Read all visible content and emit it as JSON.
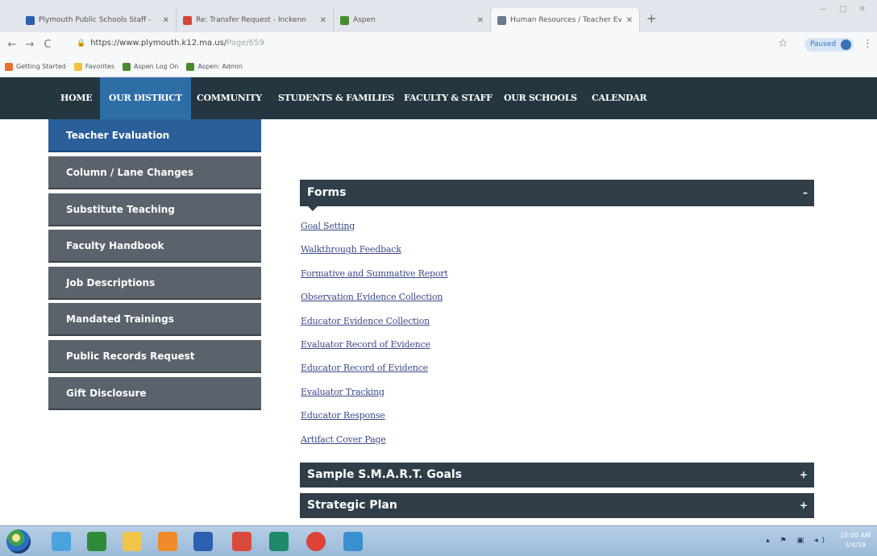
{
  "browser": {
    "tabs": [
      {
        "title": "Plymouth Public Schools Staff -",
        "favicon_color": "#2b5fb0",
        "icon": "school-favicon"
      },
      {
        "title": "Re: Transfer Request - Inckenn",
        "favicon_color": "#d44638",
        "icon": "gmail-icon"
      },
      {
        "title": "Aspen",
        "favicon_color": "#4a8a2e",
        "icon": "aspen-icon"
      },
      {
        "title": "Human Resources / Teacher Eva",
        "favicon_color": "#6a7a8c",
        "icon": "page-icon"
      }
    ],
    "url_base": "https://www.plymouth.k12.ma.us/",
    "url_path": "Page/659",
    "profile_label": "Paused",
    "bookmarks": [
      {
        "label": "Getting Started",
        "color": "#e8702a"
      },
      {
        "label": "Favorites",
        "color": "#f2c33a"
      },
      {
        "label": "Aspen Log On",
        "color": "#4a8a2e"
      },
      {
        "label": "Aspen: Admin",
        "color": "#4a8a2e"
      }
    ]
  },
  "site_nav": {
    "items": [
      "HOME",
      "OUR DISTRICT",
      "COMMUNITY",
      "STUDENTS & FAMILIES",
      "FACULTY & STAFF",
      "OUR SCHOOLS",
      "CALENDAR"
    ],
    "active": "OUR DISTRICT"
  },
  "sidebar": {
    "items": [
      "Teacher Evaluation",
      "Column / Lane Changes",
      "Substitute Teaching",
      "Faculty Handbook",
      "Job Descriptions",
      "Mandated Trainings",
      "Public Records Request",
      "Gift Disclosure"
    ],
    "active": "Teacher Evaluation"
  },
  "content": {
    "forms": {
      "title": "Forms",
      "toggle": "–",
      "links": [
        "Goal Setting",
        "Walkthrough Feedback",
        "Formative and Summative Report",
        "Observation Evidence Collection",
        "Educator Evidence Collection",
        "Evaluator Record of Evidence",
        "Educator Record of Evidence",
        "Evaluator Tracking",
        "Educator Response",
        "Artifact Cover Page"
      ]
    },
    "smart": {
      "title": "Sample S.M.A.R.T. Goals",
      "toggle": "+"
    },
    "plan": {
      "title": "Strategic Plan",
      "toggle": "+"
    }
  },
  "taskbar": {
    "apps": [
      {
        "icon": "ie-icon",
        "color": "#4aa3df"
      },
      {
        "icon": "excel-icon",
        "color": "#2e8b3a"
      },
      {
        "icon": "folder-icon",
        "color": "#f0c54a"
      },
      {
        "icon": "media-icon",
        "color": "#f08a2a"
      },
      {
        "icon": "word-icon",
        "color": "#2b5fb0"
      },
      {
        "icon": "acrobat-icon",
        "color": "#d94a3a"
      },
      {
        "icon": "publisher-icon",
        "color": "#1e8a6a"
      },
      {
        "icon": "chrome-icon",
        "color": "#db4437"
      },
      {
        "icon": "app-icon",
        "color": "#3a8fd0"
      }
    ],
    "time": "10:50 AM",
    "date": "3/4/19"
  }
}
